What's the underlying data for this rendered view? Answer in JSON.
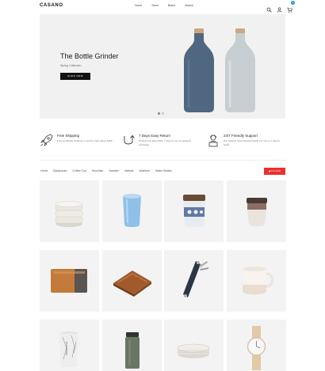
{
  "header": {
    "logo": "CASANO",
    "nav": [
      "Home",
      "Store",
      "Brand",
      "Search"
    ],
    "icons": [
      "search-icon",
      "user-icon",
      "cart-icon"
    ],
    "cart_count": "0"
  },
  "hero": {
    "title": "The Bottle Grinder",
    "subtitle": "Spring Collection",
    "button": "SHOP NOW",
    "slides": 2,
    "active_slide": 1
  },
  "features": [
    {
      "icon": "rocket-icon",
      "title": "Free Shipping",
      "desc": "Free worldwide shipping on all the order above $100"
    },
    {
      "icon": "return-arrow-icon",
      "title": "7 Days Easy Return",
      "desc": "Product any fault within 7 days for an immediately exchange."
    },
    {
      "icon": "support-agent-icon",
      "title": "24/7 Friendly Support",
      "desc": "Our Support Team Always Ready For You to 7 days a week"
    }
  ],
  "categories": [
    "Home",
    "Backpacks",
    "Coffee Cup",
    "Keychain",
    "Sweater",
    "Wallets",
    "Watches",
    "Water Bottles"
  ],
  "filter_label": "FILTER",
  "products": [
    "bowls",
    "blue-tumbler",
    "patterned-glass-cup",
    "keepcup",
    "tan-wallet",
    "zip-wallet",
    "key-organizer",
    "white-mug",
    "marble-tumbler",
    "travel-mug",
    "stacked-plates",
    "watch"
  ],
  "colors": {
    "accent_red": "#e8312f",
    "badge_blue": "#2b8de8",
    "bottle_blue": "#4f6780",
    "bottle_gray": "#c8cdd1"
  }
}
